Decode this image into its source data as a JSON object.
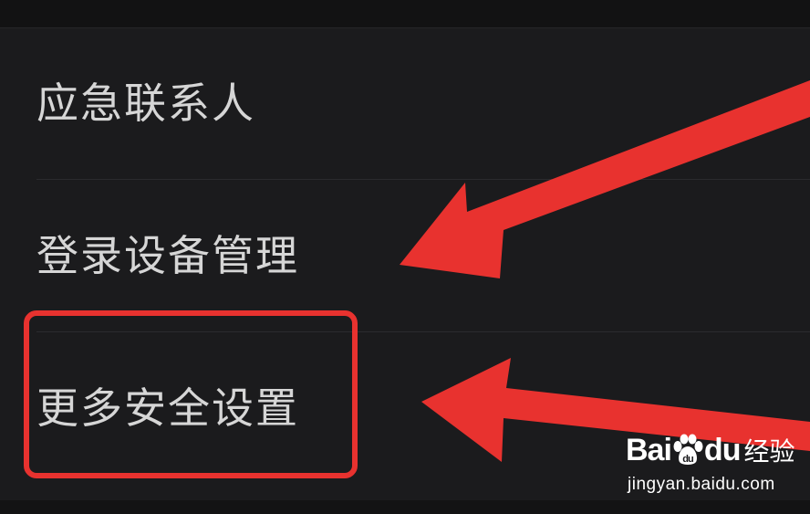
{
  "menu": {
    "items": [
      {
        "label": "应急联系人"
      },
      {
        "label": "登录设备管理"
      },
      {
        "label": "更多安全设置"
      }
    ]
  },
  "watermark": {
    "brand_a": "Bai",
    "brand_b": "du",
    "brand_cn": "经验",
    "url": "jingyan.baidu.com"
  },
  "colors": {
    "background": "#1b1b1d",
    "text": "#d6d6d6",
    "annotation": "#e8322f"
  },
  "icons": {
    "paw": "baidu-paw-icon",
    "arrow": "red-arrow-annotation"
  }
}
